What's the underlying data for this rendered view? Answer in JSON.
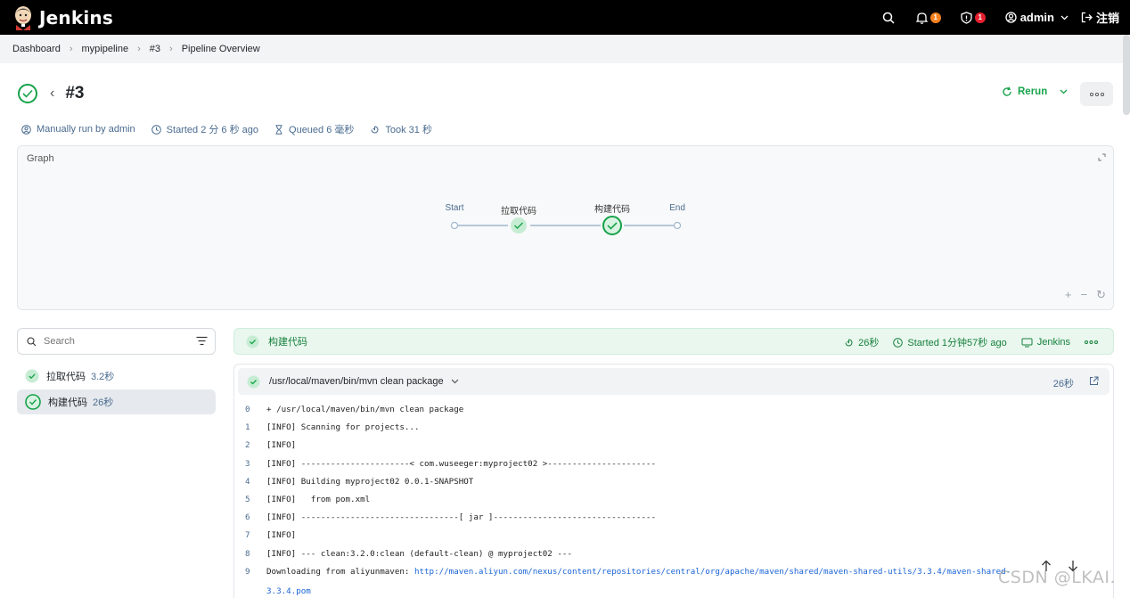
{
  "topbar": {
    "logo_text": "Jenkins",
    "notifications_count": "1",
    "security_count": "1",
    "user": "admin",
    "logout": "注销"
  },
  "breadcrumb": [
    "Dashboard",
    "mypipeline",
    "#3",
    "Pipeline Overview"
  ],
  "run": {
    "title": "#3",
    "rerun_label": "Rerun",
    "meta": {
      "manually": "Manually run by admin",
      "started": "Started 2 分 6 秒 ago",
      "queued": "Queued 6 毫秒",
      "took": "Took 31 秒"
    }
  },
  "graph": {
    "title": "Graph",
    "nodes": [
      {
        "label": "Start"
      },
      {
        "label": "拉取代码"
      },
      {
        "label": "构建代码"
      },
      {
        "label": "End"
      }
    ]
  },
  "search": {
    "placeholder": "Search"
  },
  "stages": [
    {
      "name": "拉取代码",
      "duration": "3.2秒"
    },
    {
      "name": "构建代码",
      "duration": "26秒"
    }
  ],
  "stage_detail": {
    "name": "构建代码",
    "duration": "26秒",
    "started": "Started 1分钟57秒 ago",
    "agent": "Jenkins"
  },
  "step": {
    "command": "/usr/local/maven/bin/mvn clean package",
    "duration": "26秒"
  },
  "log": [
    {
      "n": "0",
      "t": "+ /usr/local/maven/bin/mvn clean package"
    },
    {
      "n": "1",
      "t": "[INFO] Scanning for projects..."
    },
    {
      "n": "2",
      "t": "[INFO]"
    },
    {
      "n": "3",
      "t": "[INFO] ----------------------< com.wuseeger:myproject02 >----------------------"
    },
    {
      "n": "4",
      "t": "[INFO] Building myproject02 0.0.1-SNAPSHOT"
    },
    {
      "n": "5",
      "t": "[INFO]   from pom.xml"
    },
    {
      "n": "6",
      "t": "[INFO] --------------------------------[ jar ]---------------------------------"
    },
    {
      "n": "7",
      "t": "[INFO]"
    },
    {
      "n": "8",
      "t": "[INFO] --- clean:3.2.0:clean (default-clean) @ myproject02 ---"
    }
  ],
  "log_line9": {
    "n": "9",
    "prefix": "Downloading from aliyunmaven: ",
    "link": "http://maven.aliyun.com/nexus/content/repositories/central/org/apache/maven/shared/maven-shared-utils/3.3.4/maven-shared-",
    "wrap": "3.3.4.pom"
  },
  "watermark": "CSDN @LKAI.",
  "colors": {
    "success": "#17a34a",
    "link": "#1a64d6",
    "meta": "#4a6b8f"
  }
}
